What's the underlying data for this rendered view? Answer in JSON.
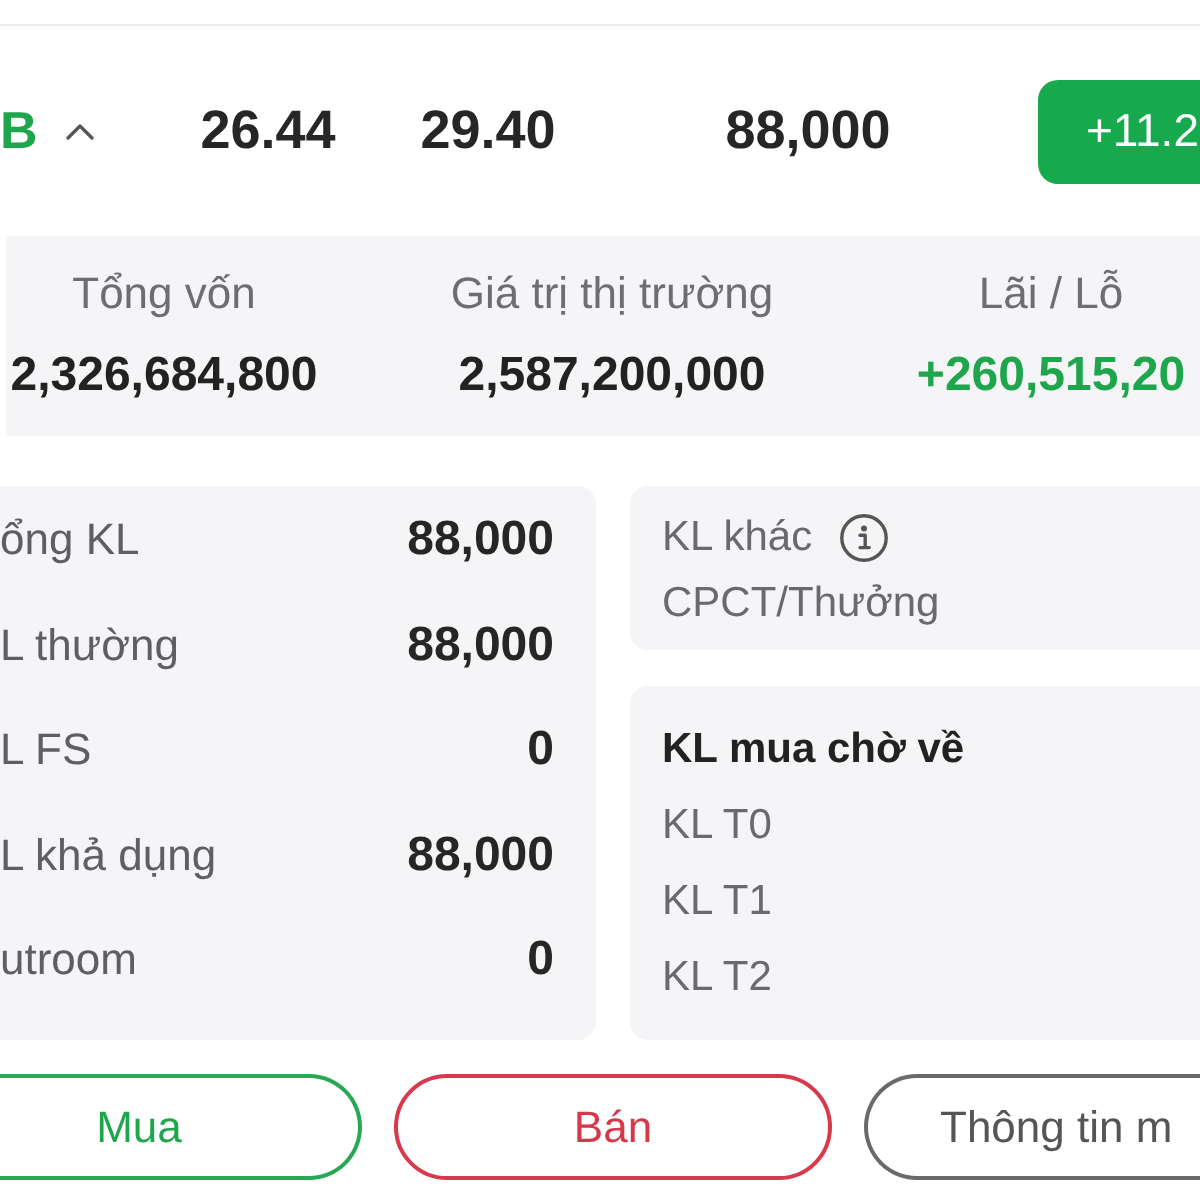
{
  "holding": {
    "symbol": "B",
    "positive": true,
    "expanded": true,
    "avg_price": "26.44",
    "market_price": "29.40",
    "quantity": "88,000",
    "change": "+11.2"
  },
  "summary": [
    {
      "label": "Tổng vốn",
      "value": "2,326,684,800",
      "positive": false
    },
    {
      "label": "Giá trị thị trường",
      "value": "2,587,200,000",
      "positive": false
    },
    {
      "label": "Lãi / Lỗ",
      "value": "+260,515,20",
      "positive": true
    }
  ],
  "volume_card": {
    "rows": [
      {
        "label": "ổng KL",
        "value": "88,000"
      },
      {
        "label": "L thường",
        "value": "88,000"
      },
      {
        "label": "L FS",
        "value": "0"
      },
      {
        "label": "L khả dụng",
        "value": "88,000"
      },
      {
        "label": "utroom",
        "value": "0"
      }
    ]
  },
  "other_card": {
    "title": "KL khác",
    "rows": [
      "CPCT/Thưởng"
    ]
  },
  "pending_card": {
    "title": "KL mua chờ về",
    "rows": [
      "KL T0",
      "KL T1",
      "KL T2"
    ]
  },
  "actions": [
    {
      "label": "Mua",
      "kind": "buy"
    },
    {
      "label": "Bán",
      "kind": "sell"
    },
    {
      "label": "Thông tin m",
      "kind": "info"
    }
  ]
}
